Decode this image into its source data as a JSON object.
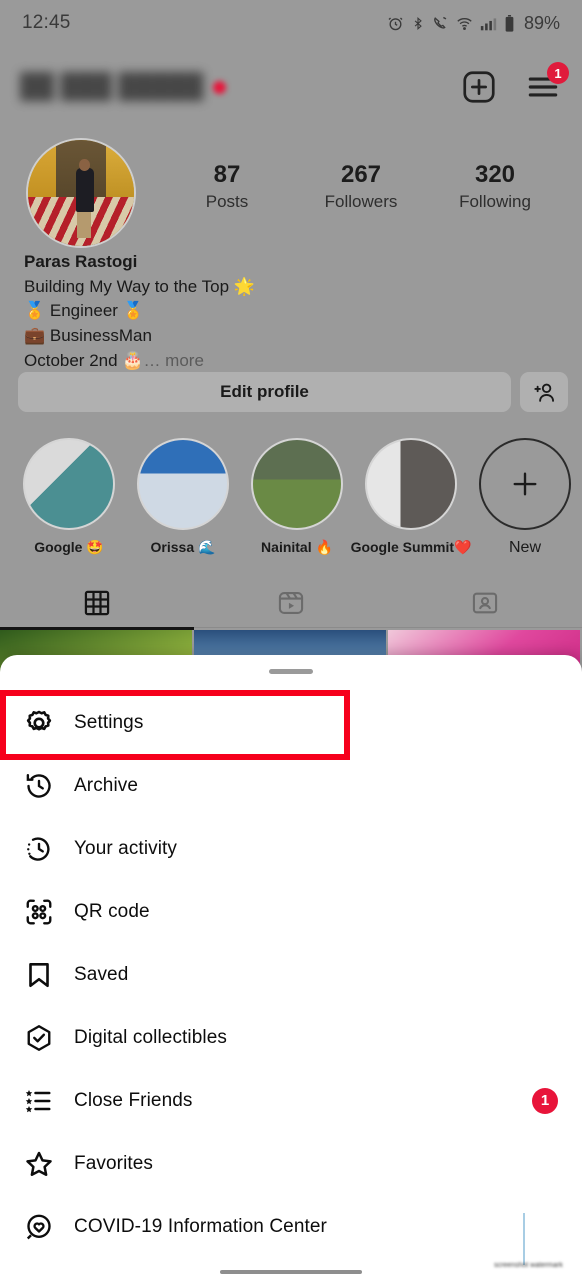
{
  "status_bar": {
    "time": "12:45",
    "battery_percent": "89%",
    "icons": [
      "alarm-icon",
      "bluetooth-icon",
      "call-mute-icon",
      "wifi-icon",
      "signal-icon",
      "battery-icon"
    ]
  },
  "header": {
    "username_blurred": "██ ███ █████",
    "add_post_icon": "plus-square-icon",
    "menu_icon": "hamburger-menu-icon",
    "menu_badge": "1"
  },
  "profile": {
    "avatar_alt": "profile-photo",
    "stats": [
      {
        "value": "87",
        "label": "Posts"
      },
      {
        "value": "267",
        "label": "Followers"
      },
      {
        "value": "320",
        "label": "Following"
      }
    ],
    "display_name": "Paras Rastogi",
    "bio_lines": [
      "Building My Way to the Top 🌟",
      "🏅 Engineer 🏅",
      "💼 BusinessMan"
    ],
    "birthday_line": "October 2nd 🎂",
    "more_label": "… more"
  },
  "actions": {
    "edit_profile_label": "Edit profile",
    "add_person_icon": "add-person-icon"
  },
  "highlights": [
    {
      "id": "hl-0",
      "label": "Google 🤩"
    },
    {
      "id": "hl-1",
      "label": "Orissa 🌊"
    },
    {
      "id": "hl-2",
      "label": "Nainital 🔥"
    },
    {
      "id": "hl-3",
      "label": "Google Summit❤️"
    }
  ],
  "highlight_new": {
    "label": "New",
    "icon": "plus-icon"
  },
  "tabs": [
    {
      "name": "grid",
      "icon": "grid-icon",
      "active": true
    },
    {
      "name": "reels",
      "icon": "reels-icon",
      "active": false
    },
    {
      "name": "tagged",
      "icon": "tagged-icon",
      "active": false
    }
  ],
  "sheet": {
    "handle": "drag-handle",
    "items": [
      {
        "icon": "gear-icon",
        "label": "Settings",
        "badge": null,
        "highlighted": true
      },
      {
        "icon": "archive-clock-icon",
        "label": "Archive",
        "badge": null,
        "highlighted": false
      },
      {
        "icon": "activity-clock-icon",
        "label": "Your activity",
        "badge": null,
        "highlighted": false
      },
      {
        "icon": "qr-code-icon",
        "label": "QR code",
        "badge": null,
        "highlighted": false
      },
      {
        "icon": "bookmark-icon",
        "label": "Saved",
        "badge": null,
        "highlighted": false
      },
      {
        "icon": "hexagon-check-icon",
        "label": "Digital collectibles",
        "badge": null,
        "highlighted": false
      },
      {
        "icon": "close-friends-list-icon",
        "label": "Close Friends",
        "badge": "1",
        "highlighted": false
      },
      {
        "icon": "star-icon",
        "label": "Favorites",
        "badge": null,
        "highlighted": false
      },
      {
        "icon": "covid-heart-icon",
        "label": "COVID-19 Information Center",
        "badge": null,
        "highlighted": false
      }
    ]
  },
  "annotation": {
    "target": "Settings",
    "color": "#f6001c"
  },
  "watermark": {
    "text": "screenshot watermark"
  },
  "colors": {
    "badge_red": "#e8143a",
    "annotation_red": "#f6001c",
    "sheet_bg": "#ffffff",
    "dim_overlay": "#9a9a9a",
    "text_primary": "#0d0d0d"
  }
}
